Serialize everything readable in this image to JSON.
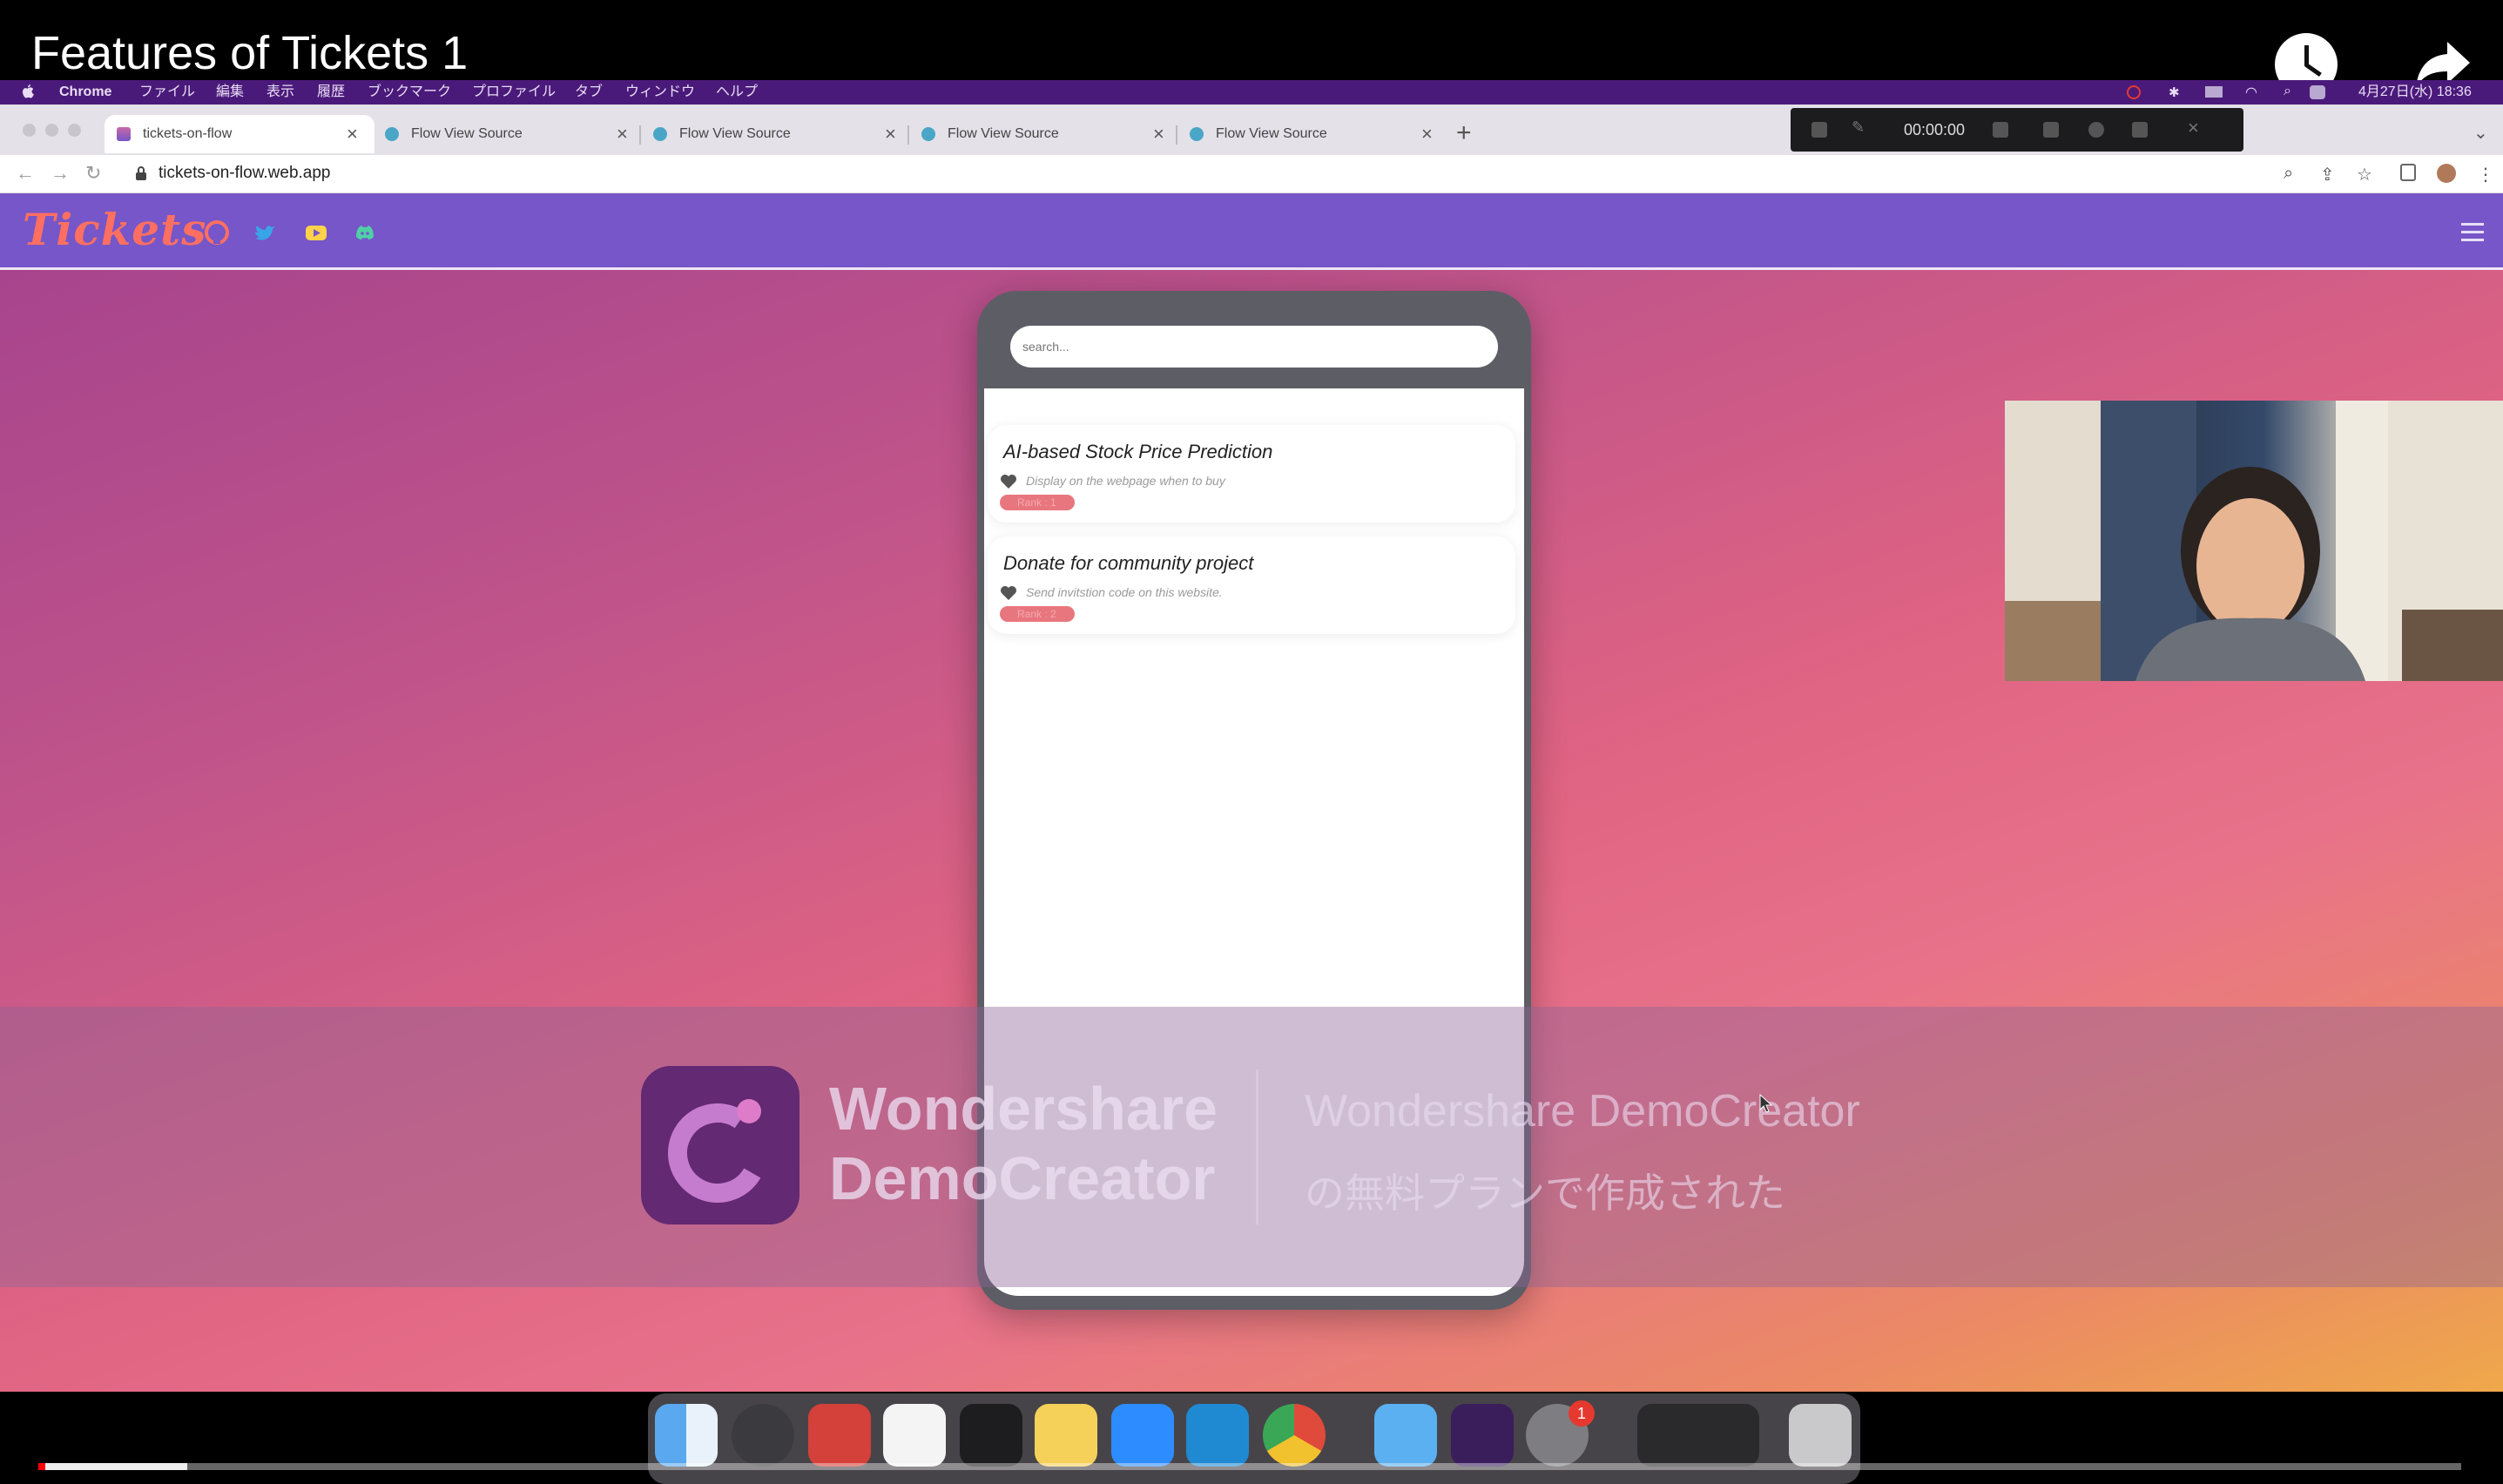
{
  "video": {
    "title": "Features of Tickets 1",
    "progress": 0.06
  },
  "menubar": {
    "items": [
      "Chrome",
      "ファイル",
      "編集",
      "表示",
      "履歴",
      "ブックマーク",
      "プロファイル",
      "タブ",
      "ウィンドウ",
      "ヘルプ"
    ],
    "clock": "4月27日(水) 18:36"
  },
  "browser": {
    "tabs": [
      {
        "label": "tickets-on-flow",
        "active": true
      },
      {
        "label": "Flow View Source",
        "active": false
      },
      {
        "label": "Flow View Source",
        "active": false
      },
      {
        "label": "Flow View Source",
        "active": false
      },
      {
        "label": "Flow View Source",
        "active": false
      }
    ],
    "url": "tickets-on-flow.web.app",
    "new_tab": "+",
    "recorder_time": "00:00:00"
  },
  "site": {
    "logo": "Tickets",
    "search_placeholder": "search...",
    "cards": [
      {
        "title": "AI-based Stock Price Prediction",
        "desc": "Display on the webpage when to buy",
        "rank": "Rank : 1"
      },
      {
        "title": "Donate for community project",
        "desc": "Send invitstion code on this website.",
        "rank": "Rank : 2"
      }
    ],
    "colors": {
      "nav": "#7656c8",
      "logo": "#ff6f61",
      "rank": "#e8767e"
    }
  },
  "watermark": {
    "brand_line1": "Wondershare",
    "brand_line2": "DemoCreator",
    "caption_line1": "Wondershare DemoCreator",
    "caption_line2": "の無料プランで作成された"
  },
  "dock": {
    "apps": [
      "finder-icon",
      "quicktime-icon",
      "photo-booth-icon",
      "slack-icon",
      "terminal-icon",
      "notes-icon",
      "zoom-icon",
      "vscode-icon",
      "chrome-icon",
      "mail-icon",
      "democreator-icon",
      "system-preferences-icon",
      "downloads-stack",
      "trash-icon"
    ],
    "badge": "1"
  }
}
